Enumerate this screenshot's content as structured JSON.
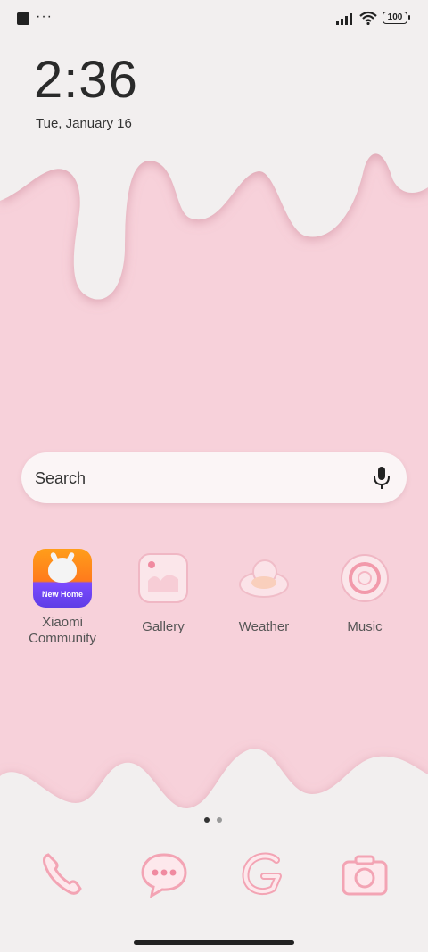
{
  "status_bar": {
    "battery": "100"
  },
  "lockclock": {
    "time": "2:36",
    "date": "Tue, January 16"
  },
  "search": {
    "placeholder": "Search"
  },
  "apps": [
    {
      "label": "Xiaomi\nCommunity",
      "badge": "New Home",
      "icon": "xiaomi-community-icon"
    },
    {
      "label": "Gallery",
      "icon": "gallery-icon"
    },
    {
      "label": "Weather",
      "icon": "weather-icon"
    },
    {
      "label": "Music",
      "icon": "music-icon"
    }
  ],
  "dock": [
    {
      "icon": "phone-icon"
    },
    {
      "icon": "messages-icon"
    },
    {
      "icon": "browser-icon"
    },
    {
      "icon": "camera-icon"
    }
  ],
  "page_indicator": {
    "pages": 2,
    "current": 1
  },
  "colors": {
    "pink": "#f6d0d8",
    "cream": "#f3f0f0",
    "drip_edge": "#d79aa8"
  }
}
